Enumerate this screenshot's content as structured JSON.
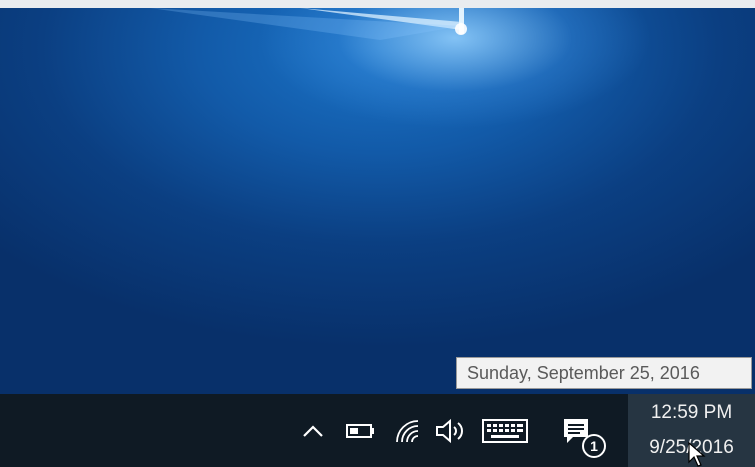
{
  "taskbar": {
    "tray_icons": {
      "show_hidden": "chevron-up-icon",
      "battery": "battery-icon",
      "network": "wifi-icon",
      "volume": "speaker-icon",
      "keyboard": "touch-keyboard-icon",
      "action_center": "action-center-icon"
    },
    "notification_count": "1",
    "clock": {
      "time": "12:59 PM",
      "date": "9/25/2016"
    }
  },
  "tooltip": {
    "text": "Sunday, September 25, 2016"
  },
  "colors": {
    "taskbar_bg": "#0f1a24",
    "clock_hover_bg": "#263542",
    "wallpaper_blue": "#125aa8",
    "tooltip_bg": "#f2f2f2"
  }
}
